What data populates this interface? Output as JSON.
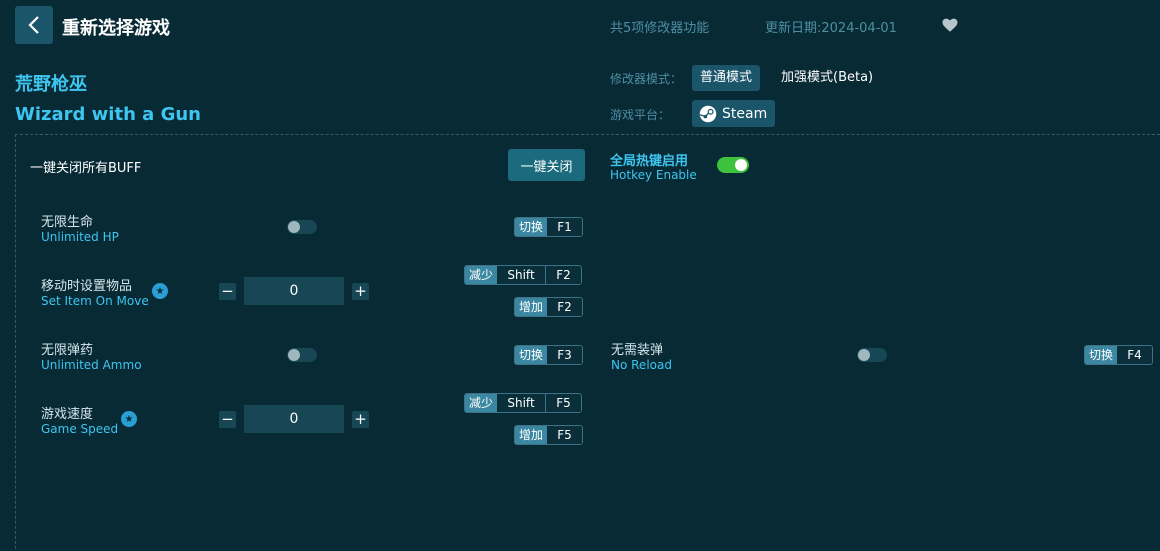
{
  "header": {
    "title": "重新选择游戏",
    "feature_count": "共5项修改器功能",
    "update_date": "更新日期:2024-04-01",
    "back_icon": "chevron-left-icon",
    "favorite_icon": "heart-icon"
  },
  "game": {
    "name_cn": "荒野枪巫",
    "name_en": "Wizard with a Gun"
  },
  "mode": {
    "label": "修改器模式：",
    "normal": "普通模式",
    "enhanced": "加强模式(Beta)",
    "selected": "普通模式"
  },
  "platform": {
    "label": "游戏平台：",
    "name": "Steam",
    "icon": "steam-icon"
  },
  "global": {
    "buff_label": "一键关闭所有BUFF",
    "close_all_btn": "一键关闭",
    "hotkey_cn": "全局热键启用",
    "hotkey_en": "Hotkey Enable",
    "hotkey_enabled": true
  },
  "options": {
    "unlimited_hp": {
      "cn": "无限生命",
      "en": "Unlimited HP",
      "enabled": false,
      "hk_action": "切换",
      "hk_key": "F1"
    },
    "set_item": {
      "cn": "移动时设置物品",
      "en": "Set Item On Move",
      "value": "0",
      "dec_action": "减少",
      "dec_mod": "Shift",
      "dec_key": "F2",
      "inc_action": "增加",
      "inc_key": "F2"
    },
    "unlimited_ammo": {
      "cn": "无限弹药",
      "en": "Unlimited Ammo",
      "enabled": false,
      "hk_action": "切换",
      "hk_key": "F3"
    },
    "no_reload": {
      "cn": "无需装弹",
      "en": "No Reload",
      "enabled": false,
      "hk_action": "切换",
      "hk_key": "F4"
    },
    "game_speed": {
      "cn": "游戏速度",
      "en": "Game Speed",
      "value": "0",
      "dec_action": "减少",
      "dec_mod": "Shift",
      "dec_key": "F5",
      "inc_action": "增加",
      "inc_key": "F5"
    }
  },
  "stepper": {
    "minus": "−",
    "plus": "+"
  },
  "colors": {
    "background": "#082a35",
    "accent": "#3ec5f0",
    "toggle_on": "#3cc23c",
    "button": "#1b5569"
  }
}
